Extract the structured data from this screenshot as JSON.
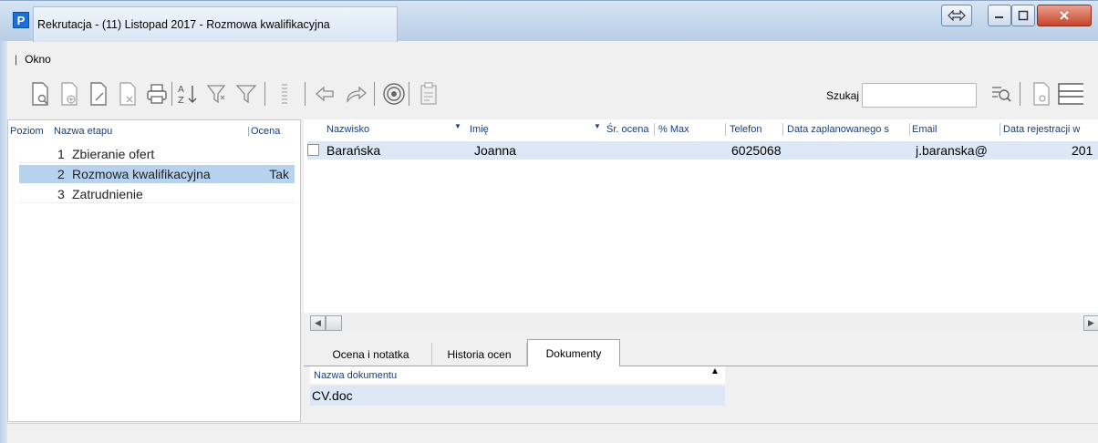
{
  "window": {
    "title": "Rekrutacja - (11) Listopad 2017 - Rozmowa kwalifikacyjna",
    "app_icon_letter": "P"
  },
  "menu": {
    "items": [
      "Okno"
    ]
  },
  "toolbar": {
    "icons": [
      "new-document-icon",
      "add-document-icon",
      "edit-document-icon",
      "delete-document-icon",
      "print-icon",
      "sort-icon",
      "filter-add-icon",
      "filter-icon",
      "columns-icon",
      "undo-icon",
      "redo-icon",
      "target-icon",
      "checklist-icon"
    ],
    "search_label": "Szukaj",
    "search_value": ""
  },
  "stages": {
    "headers": {
      "poziom": "Poziom",
      "nazwa": "Nazwa etapu",
      "ocena": "Ocena"
    },
    "rows": [
      {
        "num": "1",
        "name": "Zbieranie ofert",
        "ocena": ""
      },
      {
        "num": "2",
        "name": "Rozmowa kwalifikacyjna",
        "ocena": "Tak",
        "selected": true
      },
      {
        "num": "3",
        "name": "Zatrudnienie",
        "ocena": ""
      }
    ]
  },
  "candidates": {
    "headers": {
      "nazwisko": "Nazwisko",
      "imie": "Imię",
      "sr_ocena": "Śr. ocena",
      "max": "% Max",
      "telefon": "Telefon",
      "data_zapl": "Data zaplanowanego s",
      "email": "Email",
      "data_rej": "Data rejestracji w"
    },
    "rows": [
      {
        "nazwisko": "Barańska",
        "imie": "Joanna",
        "telefon": "6025068",
        "email": "j.baranska@",
        "data_rej": "201"
      }
    ]
  },
  "tabs": {
    "items": [
      "Ocena i notatka",
      "Historia ocen",
      "Dokumenty"
    ],
    "active": "Dokumenty"
  },
  "documents": {
    "header": "Nazwa dokumentu",
    "rows": [
      "CV.doc"
    ]
  }
}
